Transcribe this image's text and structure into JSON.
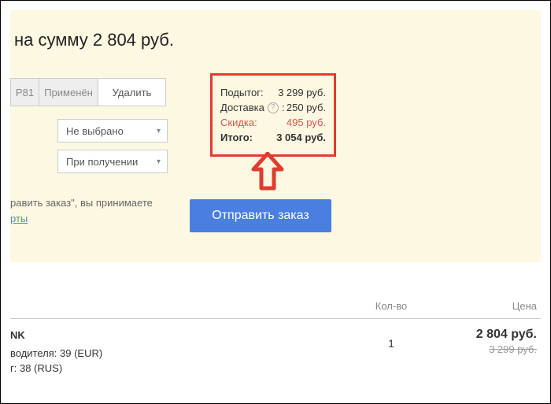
{
  "title": "на сумму 2 804 руб.",
  "promo": {
    "code": "Р81",
    "applied": "Применён",
    "delete": "Удалить"
  },
  "select1": "Не выбрано",
  "select2": "При получении",
  "terms_line1": "равить заказ\", вы принимаете",
  "terms_link": "рты",
  "summary": {
    "subtotal_label": "Подытог:",
    "subtotal_value": "3 299 руб.",
    "shipping_label": "Доставка",
    "shipping_sep": ":",
    "shipping_value": "250 руб.",
    "discount_label": "Скидка:",
    "discount_value": "495 руб.",
    "total_label": "Итого:",
    "total_value": "3 054 руб."
  },
  "submit": "Отправить заказ",
  "table": {
    "qty_header": "Кол-во",
    "price_header": "Цена"
  },
  "item": {
    "name": "NK",
    "spec1": "водителя: 39 (EUR)",
    "spec2": "г: 38 (RUS)",
    "qty": "1",
    "price_current": "2 804 руб.",
    "price_old": "3 299 руб."
  }
}
